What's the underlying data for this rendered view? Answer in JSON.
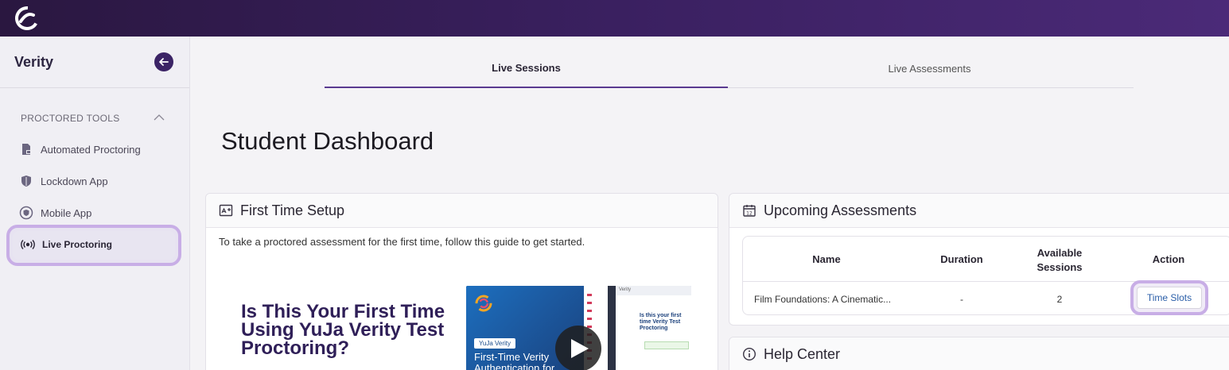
{
  "sidebar": {
    "title": "Verity",
    "section_label": "PROCTORED TOOLS",
    "items": [
      {
        "label": "Automated Proctoring"
      },
      {
        "label": "Lockdown App"
      },
      {
        "label": "Mobile App"
      },
      {
        "label": "Live Proctoring"
      }
    ]
  },
  "tabs": [
    {
      "label": "Live Sessions"
    },
    {
      "label": "Live Assessments"
    }
  ],
  "page": {
    "title": "Student Dashboard"
  },
  "first_time_setup": {
    "title": "First Time Setup",
    "description": "To take a proctored assessment for the first time, follow this guide to get started.",
    "promo_heading": "Is This Your First Time Using YuJa Verity Test Proctoring?",
    "video": {
      "tag": "YuJa Verity",
      "caption": "First-Time Verity Authentication for",
      "window_title": "Verity",
      "window_heading": "Is this your first time Verity Test Proctoring"
    }
  },
  "upcoming": {
    "title": "Upcoming Assessments",
    "columns": [
      "Name",
      "Duration",
      "Available Sessions",
      "Action"
    ],
    "rows": [
      {
        "name": "Film Foundations: A Cinematic...",
        "duration": "-",
        "sessions": "2",
        "action": "Time Slots"
      }
    ]
  },
  "help": {
    "title": "Help Center"
  },
  "colors": {
    "brand_purple": "#3b2365",
    "highlight": "#c8aee6",
    "link_blue": "#2a5ea8"
  }
}
